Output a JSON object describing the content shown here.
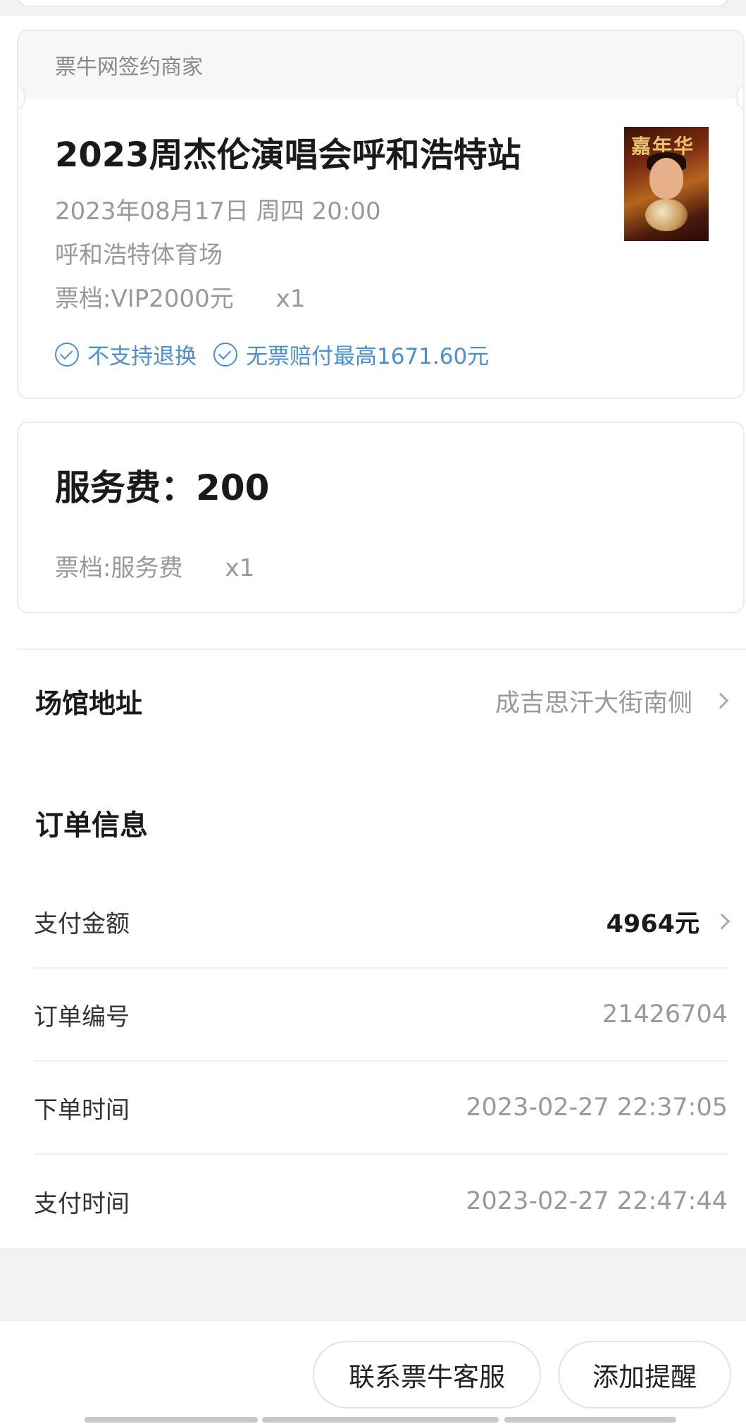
{
  "ticket": {
    "merchant_label": "票牛网签约商家",
    "title": "2023周杰伦演唱会呼和浩特站",
    "datetime": "2023年08月17日 周四 20:00",
    "venue": "呼和浩特体育场",
    "tier": "票档:VIP2000元",
    "quantity": "x1",
    "poster_text": "嘉年华",
    "tags": [
      "不支持退换",
      "无票赔付最高1671.60元"
    ]
  },
  "service_fee": {
    "title": "服务费：200",
    "tier": "票档:服务费",
    "quantity": "x1"
  },
  "venue_address": {
    "label": "场馆地址",
    "value": "成吉思汗大街南侧"
  },
  "order_info": {
    "heading": "订单信息",
    "rows": [
      {
        "label": "支付金额",
        "value": "4964元"
      },
      {
        "label": "订单编号",
        "value": "21426704"
      },
      {
        "label": "下单时间",
        "value": "2023-02-27 22:37:05"
      },
      {
        "label": "支付时间",
        "value": "2023-02-27 22:47:44"
      }
    ]
  },
  "actions": {
    "contact_service": "联系票牛客服",
    "add_reminder": "添加提醒"
  },
  "colors": {
    "accent_blue": "#4a8fd1",
    "muted_text": "#999999",
    "primary_text": "#1a1a1a"
  }
}
